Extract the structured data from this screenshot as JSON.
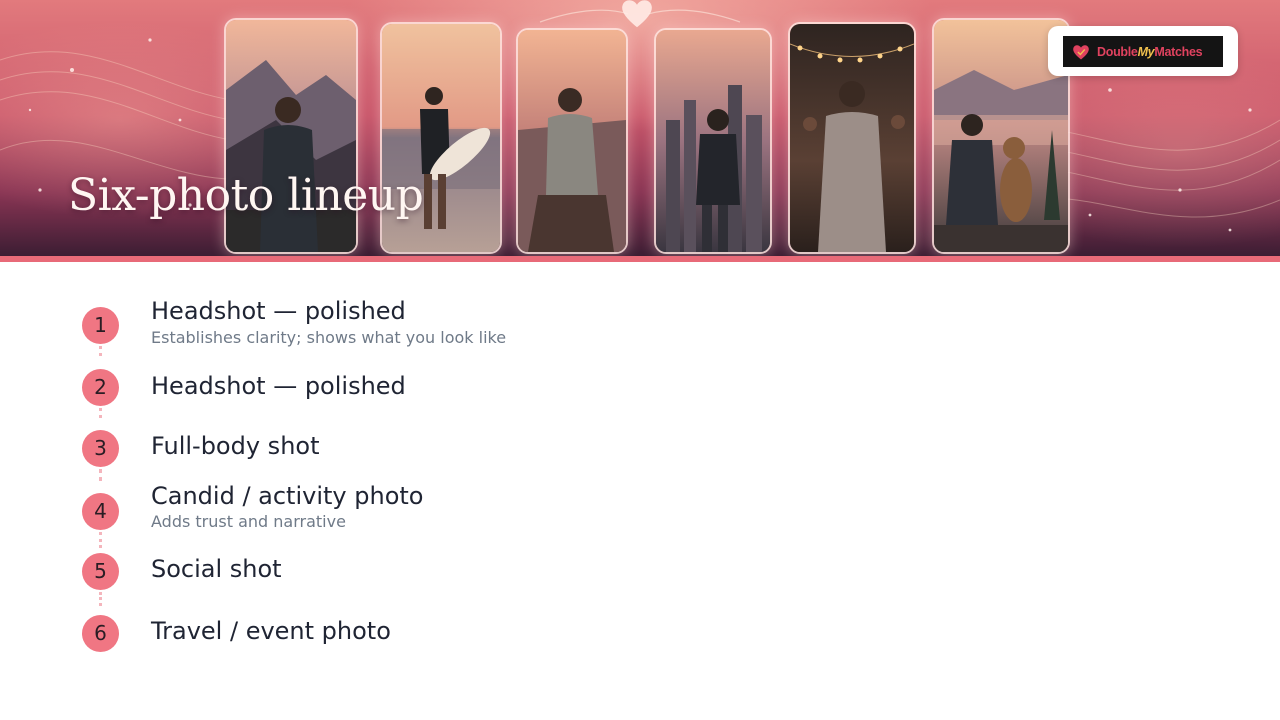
{
  "slide": {
    "title": "Six-photo lineup",
    "brand": {
      "part1": "Double",
      "part2": "My",
      "part3": "Matches",
      "brand_colors": [
        "#e0425f",
        "#f2c14e",
        "#141414"
      ]
    }
  },
  "banner": {
    "photos": [
      {
        "icon": "mountain-hiker-photo"
      },
      {
        "icon": "beach-surfer-photo"
      },
      {
        "icon": "cliff-sunset-photo"
      },
      {
        "icon": "city-skyline-photo"
      },
      {
        "icon": "string-lights-party-photo"
      },
      {
        "icon": "lake-dog-photo"
      }
    ]
  },
  "lineup": [
    {
      "number": "1",
      "title": "Headshot — polished",
      "subtitle": "Establishes clarity; shows what you look like"
    },
    {
      "number": "2",
      "title": "Headshot — polished",
      "subtitle": ""
    },
    {
      "number": "3",
      "title": "Full-body shot",
      "subtitle": ""
    },
    {
      "number": "4",
      "title": "Candid / activity photo",
      "subtitle": "Adds trust and narrative"
    },
    {
      "number": "5",
      "title": "Social shot",
      "subtitle": ""
    },
    {
      "number": "6",
      "title": "Travel / event photo",
      "subtitle": ""
    }
  ],
  "colors": {
    "accent": "#f07683",
    "title_text": "#1f2433",
    "subtitle_text": "#6f7a88"
  }
}
